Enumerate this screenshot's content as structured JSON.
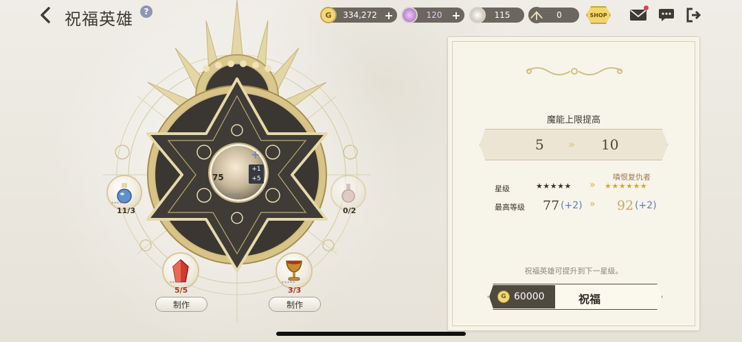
{
  "header": {
    "title": "祝福英雄",
    "help": "?"
  },
  "currencies": [
    {
      "name": "gold",
      "value": "334,272",
      "icon": "G",
      "plus": "+"
    },
    {
      "name": "crystal",
      "value": "120",
      "icon": "",
      "plus": "+"
    },
    {
      "name": "stamina",
      "value": "115",
      "icon": ""
    },
    {
      "name": "arrow-token",
      "value": "0",
      "icon": ""
    }
  ],
  "shop_label": "SHOP",
  "hero": {
    "level": "75",
    "bonus_top": "+1",
    "bonus_bottom": "+5",
    "stars": "*****",
    "plus": "+"
  },
  "materials": [
    {
      "id": "potion",
      "count": "11/3",
      "stars": "*****"
    },
    {
      "id": "flask",
      "count": "0/2",
      "stars": ""
    },
    {
      "id": "red-crystal",
      "count": "5/5",
      "stars": "*****",
      "craft": "制作"
    },
    {
      "id": "goblet",
      "count": "3/3",
      "stars": "*****",
      "craft": "制作"
    }
  ],
  "panel": {
    "heading": "魔能上限提高",
    "range_from": "5",
    "range_to": "10",
    "star_label": "星级",
    "stars_now": "★★★★★",
    "stars_next": "★★★★★★",
    "next_title": "嗔恨复仇者",
    "maxlv_label": "最高等级",
    "lv_now": "77",
    "lv_now_plus": "(+2)",
    "lv_next": "92",
    "lv_next_plus": "(+2)",
    "hint": "祝福英雄可提升到下一星级。",
    "cost": "60000",
    "cost_icon": "G",
    "bless_label": "祝福"
  },
  "colors": {
    "gold": "#d3b04e",
    "star_blue": "#5b7dbd",
    "panel_bg": "#f7f4ea"
  }
}
